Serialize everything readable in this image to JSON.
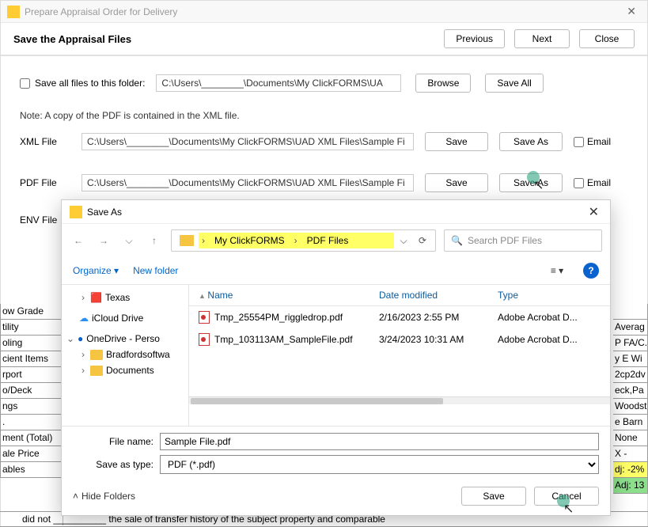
{
  "window": {
    "title": "Prepare Appraisal Order for Delivery",
    "close_icon": "✕"
  },
  "header": {
    "title": "Save the Appraisal Files",
    "previous": "Previous",
    "next": "Next",
    "close": "Close"
  },
  "main": {
    "save_all_label": "Save all files to this folder:",
    "save_all_path": "C:\\Users\\________\\Documents\\My ClickFORMS\\UA",
    "browse": "Browse",
    "save_all_btn": "Save All",
    "note": "Note: A copy of the PDF is contained in the XML file.",
    "xml_label": "XML File",
    "xml_path": "C:\\Users\\________\\Documents\\My ClickFORMS\\UAD XML Files\\Sample Fi",
    "pdf_label": "PDF File",
    "pdf_path": "C:\\Users\\________\\Documents\\My ClickFORMS\\UAD XML Files\\Sample Fi",
    "env_label": "ENV File",
    "save": "Save",
    "save_as": "Save As",
    "email": "Email"
  },
  "bg_left": [
    "ow Grade",
    "tility",
    "oling",
    "cient Items",
    "rport",
    "o/Deck",
    "ngs",
    ".",
    "ment (Total)",
    "ale Price",
    "ables"
  ],
  "bg_right": [
    "",
    "Averag",
    "P FA/C.",
    "y E Wi",
    "2cp2dv",
    "eck,Pa",
    "Woodst",
    "e Barn",
    "None",
    "X   -",
    "dj: -2%",
    "Adj: 13"
  ],
  "bg_bottom": "did not __________ the sale of transfer history of the subject property and comparable",
  "saveas": {
    "title": "Save As",
    "close_icon": "✕",
    "bc_seg1": "My ClickFORMS",
    "bc_seg2": "PDF Files",
    "search_placeholder": "Search PDF Files",
    "organize": "Organize",
    "new_folder": "New folder",
    "help": "?",
    "tree": {
      "texas": "Texas",
      "icloud": "iCloud Drive",
      "onedrive": "OneDrive - Perso",
      "bradford": "Bradfordsoftwa",
      "documents": "Documents"
    },
    "cols": {
      "name": "Name",
      "date": "Date modified",
      "type": "Type"
    },
    "files": [
      {
        "name": "Tmp_25554PM_riggledrop.pdf",
        "date": "2/16/2023 2:55 PM",
        "type": "Adobe Acrobat D..."
      },
      {
        "name": "Tmp_103113AM_SampleFile.pdf",
        "date": "3/24/2023 10:31 AM",
        "type": "Adobe Acrobat D..."
      }
    ],
    "filename_label": "File name:",
    "filename_value": "Sample File.pdf",
    "filetype_label": "Save as type:",
    "filetype_value": "PDF (*.pdf)",
    "hide_folders": "Hide Folders",
    "save": "Save",
    "cancel": "Cancel"
  }
}
